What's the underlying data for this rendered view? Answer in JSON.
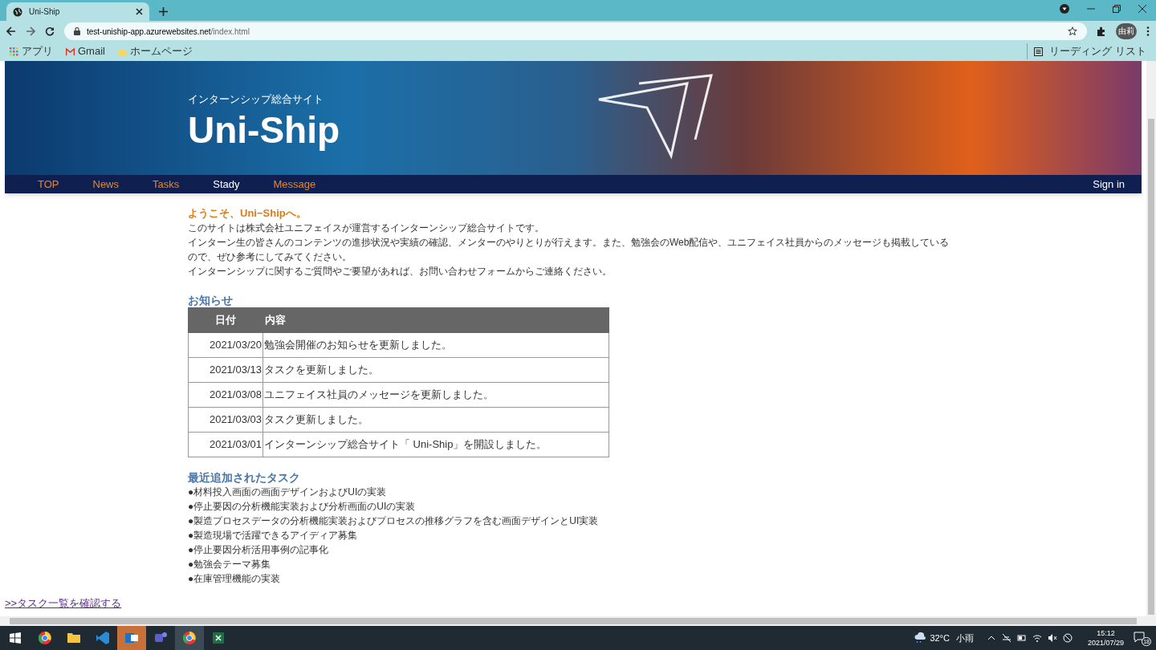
{
  "browser": {
    "tab_title": "Uni-Ship",
    "url_host": "test-uniship-app.azurewebsites.net",
    "url_path": "/index.html",
    "bookmarks": [
      {
        "kind": "apps",
        "label": "アプリ"
      },
      {
        "kind": "gmail",
        "label": "Gmail"
      },
      {
        "kind": "folder",
        "label": "ホームページ"
      }
    ],
    "reading_list": "リーディング リスト",
    "profile": "由莉"
  },
  "banner": {
    "subtitle": "インターンシップ総合サイト",
    "title": "Uni-Ship"
  },
  "nav": {
    "items": [
      {
        "label": "TOP",
        "selected": false
      },
      {
        "label": "News",
        "selected": false
      },
      {
        "label": "Tasks",
        "selected": false
      },
      {
        "label": "Stady",
        "selected": true
      },
      {
        "label": "Message",
        "selected": false
      }
    ],
    "sign_in": "Sign in"
  },
  "intro": {
    "heading": "ようこそ、Uni−Shipへ。",
    "paragraphs": [
      "このサイトは株式会社ユニフェイスが運営するインターンシップ総合サイトです。",
      "インターン生の皆さんのコンテンツの進捗状況や実績の確認、メンターのやりとりが行えます。また、勉強会のWeb配信や、ユニフェイス社員からのメッセージも掲載しているので、ぜひ参考にしてみてください。",
      "インターンシップに関するご質問やご要望があれば、お問い合わせフォームからご連絡ください。"
    ]
  },
  "news": {
    "heading": "お知らせ",
    "columns": [
      "日付",
      "内容"
    ],
    "rows": [
      {
        "date": "2021/03/20",
        "content": "勉強会開催のお知らせを更新しました。"
      },
      {
        "date": "2021/03/13",
        "content": "タスクを更新しました。"
      },
      {
        "date": "2021/03/08",
        "content": "ユニフェイス社員のメッセージを更新しました。"
      },
      {
        "date": "2021/03/03",
        "content": "タスク更新しました。"
      },
      {
        "date": "2021/03/01",
        "content": "インターンシップ総合サイト「 Uni-Ship」を開設しました。"
      }
    ]
  },
  "tasks": {
    "heading": "最近追加されたタスク",
    "items": [
      "●材料投入画面の画面デザインおよびUIの実装",
      "●停止要因の分析機能実装および分析画面のUIの実装",
      "●製造プロセスデータの分析機能実装およびプロセスの推移グラフを含む画面デザインとUI実装",
      "●製造現場で活躍できるアイディア募集",
      "●停止要因分析活用事例の記事化",
      "●勉強会テーマ募集",
      "●在庫管理機能の実装"
    ],
    "link": ">>タスク一覧を確認する"
  },
  "taskbar": {
    "weather": "32°C",
    "weather_text": "小雨",
    "time": "15:12",
    "date": "2021/07/29",
    "notifications": "18"
  }
}
